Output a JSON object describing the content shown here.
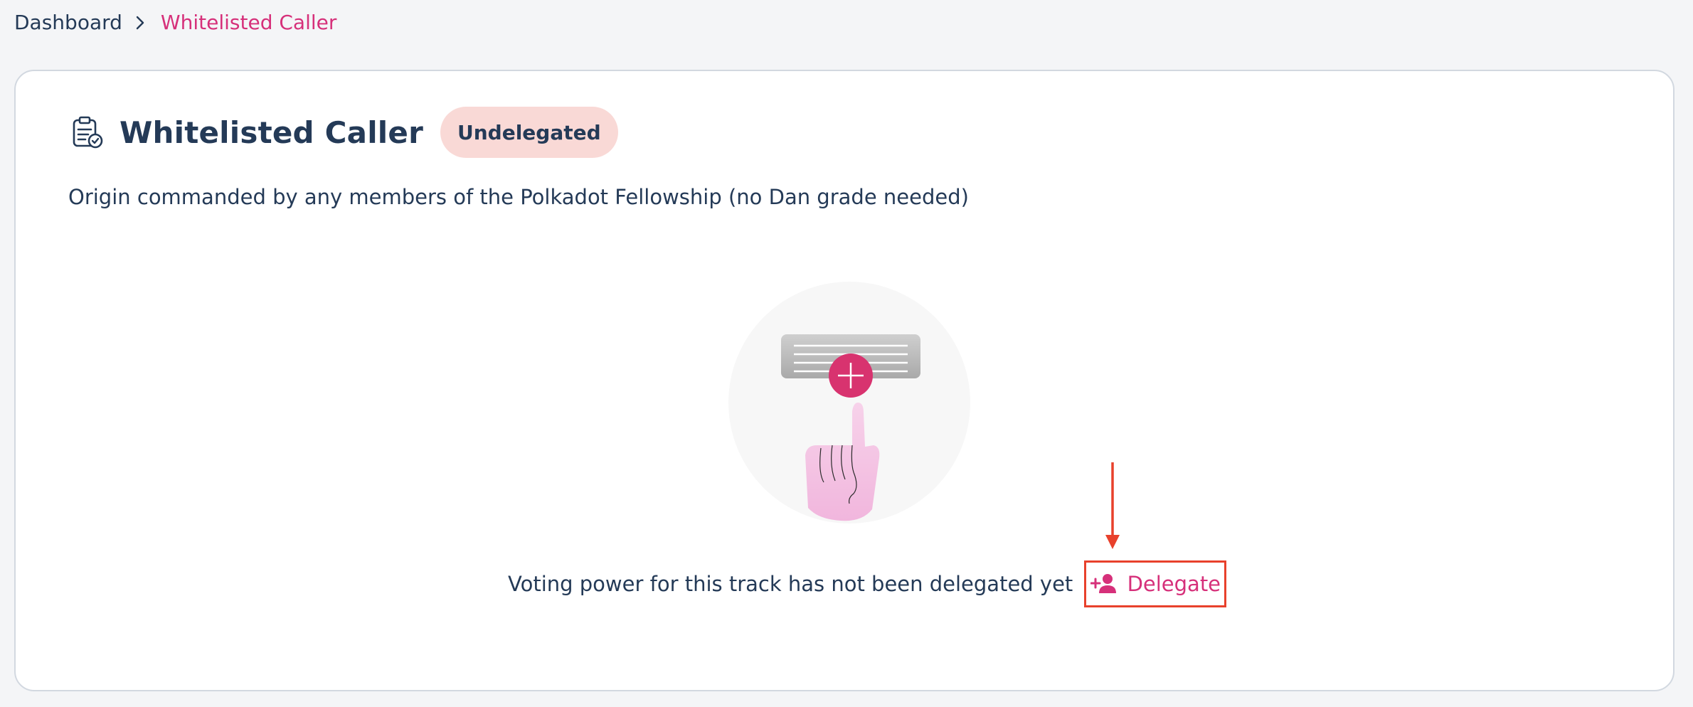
{
  "breadcrumb": {
    "root": "Dashboard",
    "current": "Whitelisted Caller"
  },
  "track": {
    "title": "Whitelisted Caller",
    "status_badge": "Undelegated",
    "description": "Origin commanded by any members of the Polkadot Fellowship (no Dan grade needed)"
  },
  "empty_state": {
    "message": "Voting power for this track has not been delegated yet",
    "delegate_label": "Delegate"
  },
  "icons": {
    "track": "clipboard-check-icon",
    "separator": "chevron-right-icon",
    "delegate": "add-user-icon",
    "illustration": "hand-press-plus-icon"
  },
  "colors": {
    "accent": "#d6307a",
    "text": "#243a57",
    "badge_bg": "#f9d9d6",
    "highlight": "#e8412c"
  }
}
